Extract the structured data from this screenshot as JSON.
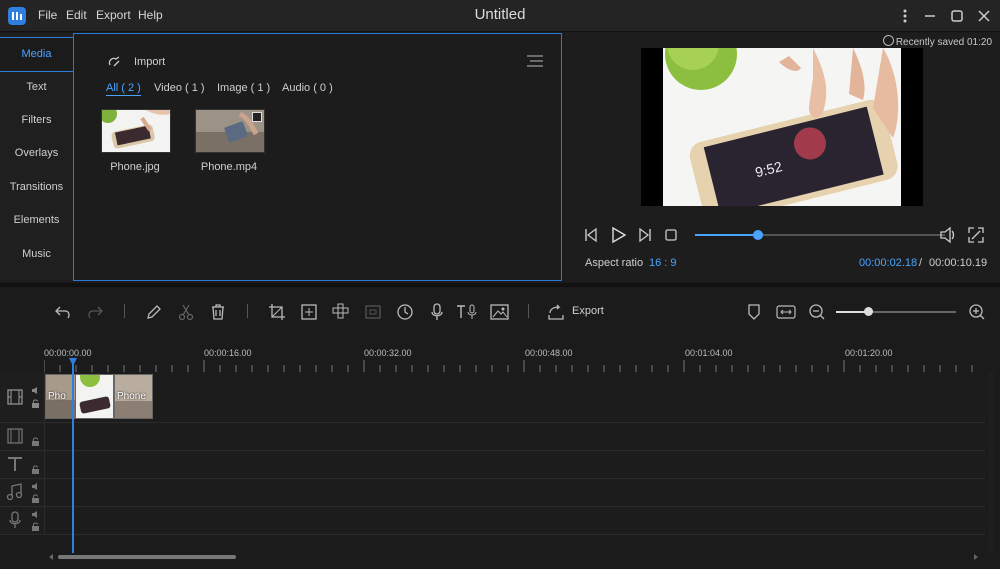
{
  "app": {
    "title": "Untitled",
    "menu": [
      "File",
      "Edit",
      "Export",
      "Help"
    ]
  },
  "left_tabs": [
    "Media",
    "Text",
    "Filters",
    "Overlays",
    "Transitions",
    "Elements",
    "Music"
  ],
  "media": {
    "import_label": "Import",
    "filters": [
      "All ( 2 )",
      "Video ( 1 )",
      "Image ( 1 )",
      "Audio ( 0 )"
    ],
    "items": [
      {
        "name": "Phone.jpg",
        "type": "image"
      },
      {
        "name": "Phone.mp4",
        "type": "video"
      }
    ]
  },
  "preview": {
    "saved_text": "Recently saved 01:20",
    "aspect_label": "Aspect ratio",
    "aspect_value": "16 : 9",
    "current_time": "00:00:02.18",
    "separator": "/",
    "total_time": "00:00:10.19",
    "progress": 0.25
  },
  "toolbar": {
    "export_label": "Export",
    "zoom_level": 0.33
  },
  "timeline": {
    "ruler_labels": [
      "00:00:00.00",
      "00:00:16.00",
      "00:00:32.00",
      "00:00:48.00",
      "00:01:04.00",
      "00:01:20.00"
    ],
    "clips": [
      {
        "label": "Pho"
      },
      {
        "label": ""
      },
      {
        "label": "Phone"
      }
    ]
  },
  "colors": {
    "accent": "#4aa3ff",
    "panel_border": "#2a79d6",
    "background": "#1b1b1b"
  }
}
